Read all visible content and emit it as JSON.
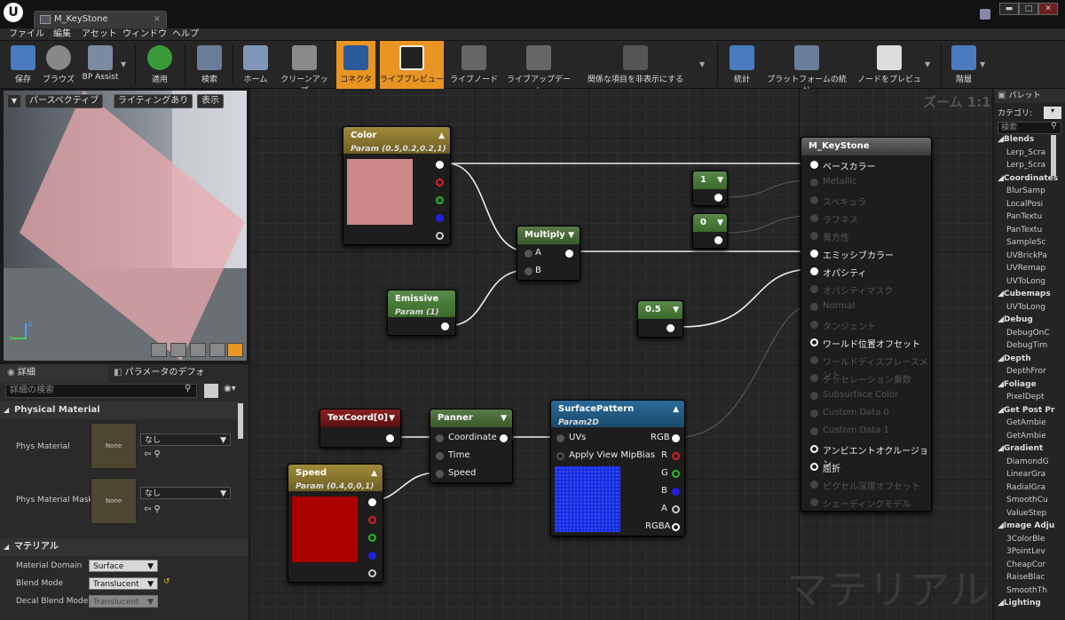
{
  "app": {
    "logo": "U",
    "tab": "M_KeyStone",
    "tab_close": "×",
    "win_min": "▬",
    "win_max": "□",
    "win_close": "✕"
  },
  "menu": [
    "ファイル",
    "編集",
    "アセット",
    "ウィンドウ",
    "ヘルプ"
  ],
  "toolbar": {
    "items": [
      "保存",
      "ブラウズ",
      "BP Assist",
      "適用",
      "検索",
      "ホーム",
      "クリーンアップ",
      "コネクタ",
      "ライブプレビュー",
      "ライブノード",
      "ライブアップデート",
      "関係な項目を非表示にする",
      "統計",
      "プラットフォームの統計",
      "ノードをプレビュー",
      "階層"
    ]
  },
  "viewport": {
    "perspective": "パースペクティブ",
    "lighting": "ライティングあり",
    "show": "表示",
    "axis_x": "x",
    "axis_z": "z"
  },
  "details": {
    "tab1": "詳細",
    "tab2": "パラメータのデフォル",
    "search_placeholder": "詳細の検索",
    "sections": {
      "physical": "Physical Material",
      "material": "マテリアル"
    },
    "phys_material": "Phys Material",
    "phys_material_mask": "Phys Material Mask",
    "none": "None",
    "nashi": "なし",
    "material_domain": "Material Domain",
    "material_domain_value": "Surface",
    "blend_mode": "Blend Mode",
    "blend_mode_value": "Translucent",
    "decal_blend_mode": "Decal Blend Mode",
    "decal_blend_mode_value": "Translucent"
  },
  "graph": {
    "zoom": "ズーム 1:1",
    "watermark": "マテリアル"
  },
  "nodes": {
    "color": {
      "title": "Color",
      "sub": "Param (0.5,0.2,0.2,1)"
    },
    "multiply": {
      "title": "Multiply",
      "a": "A",
      "b": "B"
    },
    "emissive": {
      "title": "Emissive",
      "sub": "Param (1)"
    },
    "one": {
      "title": "1"
    },
    "zero": {
      "title": "0"
    },
    "half": {
      "title": "0.5"
    },
    "texcoord": {
      "title": "TexCoord[0]"
    },
    "panner": {
      "title": "Panner",
      "coordinate": "Coordinate",
      "time": "Time",
      "speed": "Speed"
    },
    "speed": {
      "title": "Speed",
      "sub": "Param (0.4,0,0,1)"
    },
    "surface": {
      "title": "SurfacePattern",
      "sub": "Param2D",
      "uvs": "UVs",
      "mip": "Apply View MipBias",
      "rgb": "RGB",
      "r": "R",
      "g": "G",
      "b": "B",
      "a": "A",
      "rgba": "RGBA"
    },
    "result": {
      "title": "M_KeyStone",
      "pins": [
        "ベースカラー",
        "Metallic",
        "スペキュラ",
        "ラフネス",
        "異方性",
        "エミッシブカラー",
        "オパシティ",
        "オパシティマスク",
        "Normal",
        "タンジェント",
        "ワールド位置オフセット",
        "ワールドディスプレースメント",
        "テッセレーション乗数",
        "Subsurface Color",
        "Custom Data 0",
        "Custom Data 1",
        "アンビエントオクルージョン",
        "屈折",
        "ピクセル深度オフセット",
        "シェーディングモデル"
      ]
    }
  },
  "palette": {
    "title": "パレット",
    "category": "カテゴリ:",
    "search": "検索",
    "items": [
      {
        "c": "Blends"
      },
      {
        "i": "Lerp_Scra"
      },
      {
        "i": "Lerp_Scra"
      },
      {
        "c": "Coordinates"
      },
      {
        "i": "BlurSamp"
      },
      {
        "i": "LocalPosi"
      },
      {
        "i": "PanTextu"
      },
      {
        "i": "PanTextu"
      },
      {
        "i": "SampleSc"
      },
      {
        "i": "UVBrickPa"
      },
      {
        "i": "UVRemap"
      },
      {
        "i": "UVToLong"
      },
      {
        "c": "Cubemaps"
      },
      {
        "i": "UVToLong"
      },
      {
        "c": "Debug"
      },
      {
        "i": "DebugOnC"
      },
      {
        "i": "DebugTim"
      },
      {
        "c": "Depth"
      },
      {
        "i": "DepthFror"
      },
      {
        "c": "Foliage"
      },
      {
        "i": "PixelDept"
      },
      {
        "c": "Get Post Pr"
      },
      {
        "i": "GetAmbie"
      },
      {
        "i": "GetAmbie"
      },
      {
        "c": "Gradient"
      },
      {
        "i": "DiamondG"
      },
      {
        "i": "LinearGra"
      },
      {
        "i": "RadialGra"
      },
      {
        "i": "SmoothCu"
      },
      {
        "i": "ValueStep"
      },
      {
        "c": "Image Adju"
      },
      {
        "i": "3ColorBle"
      },
      {
        "i": "3PointLev"
      },
      {
        "i": "CheapCor"
      },
      {
        "i": "RaiseBlac"
      },
      {
        "i": "SmoothTh"
      },
      {
        "c": "Lighting"
      }
    ]
  },
  "colors": {
    "accent": "#e89523",
    "color_param": "#cc8888",
    "speed_param": "#aa0000",
    "texture": "#1a2fe0"
  }
}
